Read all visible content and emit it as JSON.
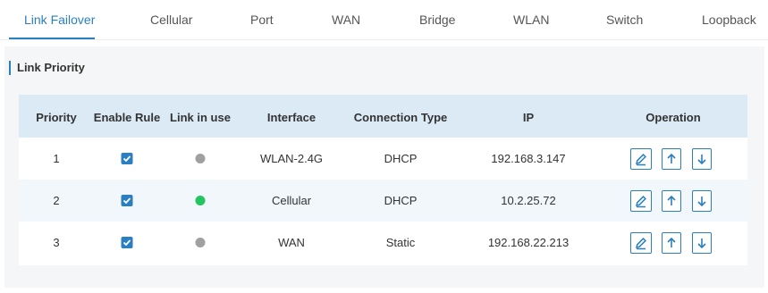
{
  "tabs": [
    {
      "label": "Link Failover",
      "active": true
    },
    {
      "label": "Cellular",
      "active": false
    },
    {
      "label": "Port",
      "active": false
    },
    {
      "label": "WAN",
      "active": false
    },
    {
      "label": "Bridge",
      "active": false
    },
    {
      "label": "WLAN",
      "active": false
    },
    {
      "label": "Switch",
      "active": false
    },
    {
      "label": "Loopback",
      "active": false
    }
  ],
  "section": {
    "title": "Link Priority"
  },
  "table": {
    "headers": [
      "Priority",
      "Enable Rule",
      "Link in use",
      "Interface",
      "Connection Type",
      "IP",
      "Operation"
    ],
    "rows": [
      {
        "priority": "1",
        "enabled": true,
        "link_in_use": false,
        "interface": "WLAN-2.4G",
        "connection_type": "DHCP",
        "ip": "192.168.3.147"
      },
      {
        "priority": "2",
        "enabled": true,
        "link_in_use": true,
        "interface": "Cellular",
        "connection_type": "DHCP",
        "ip": "10.2.25.72"
      },
      {
        "priority": "3",
        "enabled": true,
        "link_in_use": false,
        "interface": "WAN",
        "connection_type": "Static",
        "ip": "192.168.22.213"
      }
    ]
  },
  "icons": {
    "edit": "edit-icon",
    "move_up": "arrow-up-icon",
    "move_down": "arrow-down-icon",
    "checkbox": "checkmark-icon"
  },
  "colors": {
    "accent": "#2a7fc1",
    "link_active": "#22c55e",
    "link_inactive": "#a0a0a0",
    "header_bg": "#dbeaf5"
  }
}
